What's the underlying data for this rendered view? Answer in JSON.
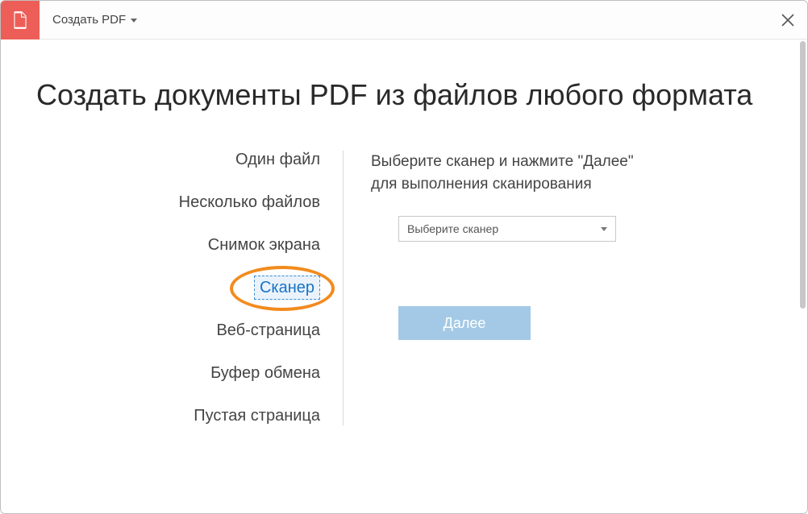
{
  "titlebar": {
    "menu_label": "Создать PDF"
  },
  "heading": "Создать документы PDF из файлов любого формата",
  "options": [
    "Один файл",
    "Несколько файлов",
    "Снимок экрана",
    "Сканер",
    "Веб-страница",
    "Буфер обмена",
    "Пустая страница"
  ],
  "selected_index": 3,
  "right": {
    "instruction": "Выберите сканер и нажмите \"Далее\" для выполнения сканирования",
    "select_placeholder": "Выберите сканер",
    "next_label": "Далее"
  }
}
